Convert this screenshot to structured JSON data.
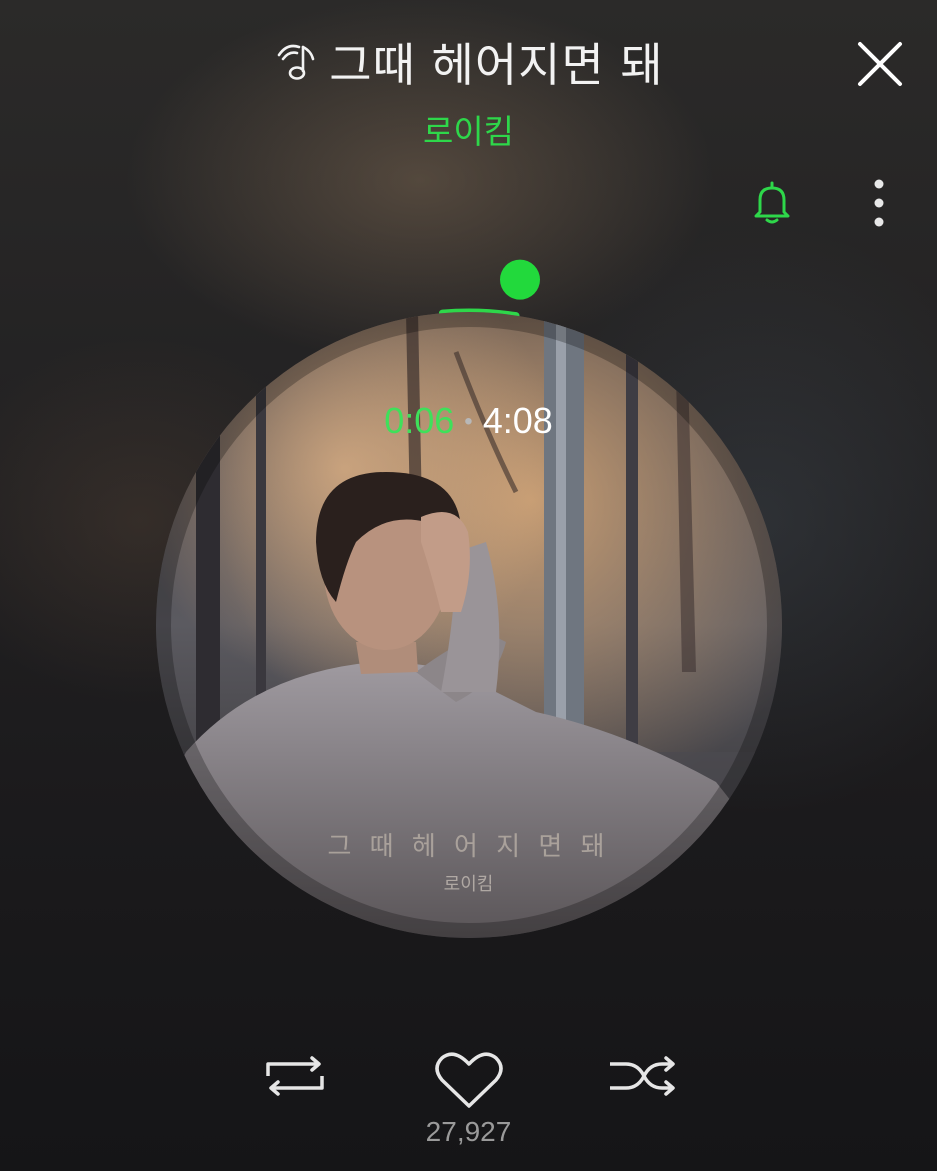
{
  "header": {
    "song_title": "그때 헤어지면 돼",
    "artist": "로이킴",
    "title_icon": "music-note-icon",
    "close_icon": "close-icon",
    "notify_icon": "bell-icon",
    "more_icon": "more-vertical-icon"
  },
  "player": {
    "current_time": "0:06",
    "total_time": "4:08",
    "separator": "•",
    "progress_fraction": 0.024
  },
  "album_art": {
    "title_text": "그 때 헤 어 지 면 돼",
    "artist_text": "로이킴"
  },
  "controls": {
    "repeat_icon": "repeat-icon",
    "like_icon": "heart-icon",
    "shuffle_icon": "shuffle-icon",
    "like_count": "27,927"
  },
  "colors": {
    "accent": "#2ed74a",
    "text_primary": "#f2f2f2",
    "text_muted": "#9a9a9a"
  }
}
